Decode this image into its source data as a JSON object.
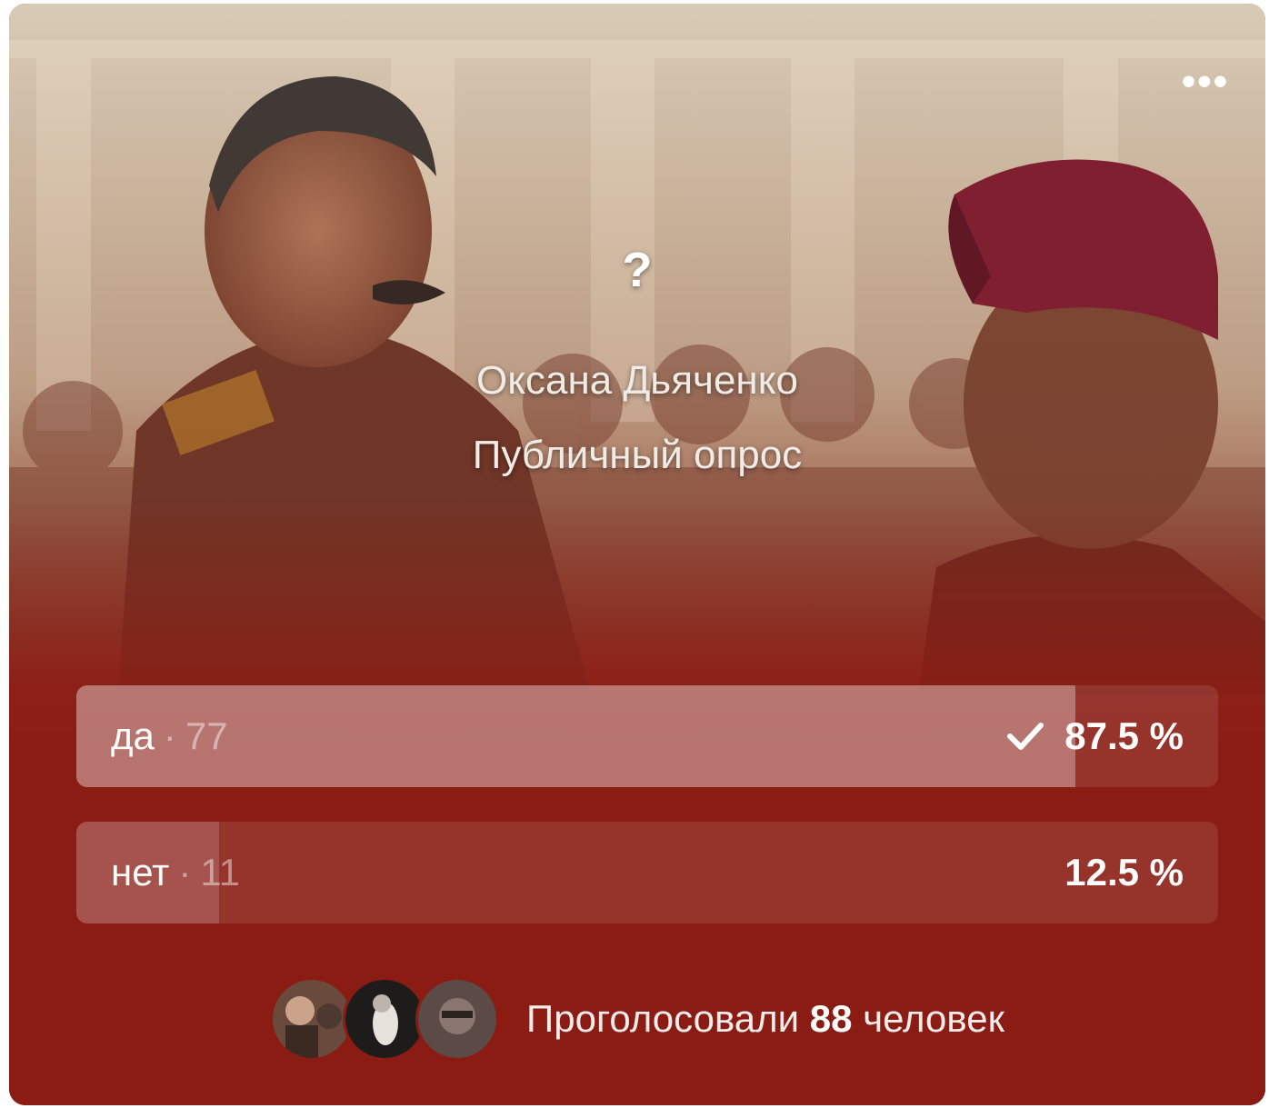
{
  "poll": {
    "question": "?",
    "author": "Оксана Дьяченко",
    "type_label": "Публичный опрос",
    "menu_icon": "more-horizontal-icon",
    "options": [
      {
        "label": "да",
        "separator": "·",
        "count": "77",
        "percent_text": "87.5 %",
        "fraction": 0.875,
        "chosen": true
      },
      {
        "label": "нет",
        "separator": "·",
        "count": "11",
        "percent_text": "12.5 %",
        "fraction": 0.125,
        "chosen": false
      }
    ],
    "footer": {
      "prefix": "Проголосовали",
      "count": "88",
      "suffix": "человек"
    }
  },
  "colors": {
    "card_bg": "#8b1c14",
    "accent_text": "#ffffff"
  }
}
